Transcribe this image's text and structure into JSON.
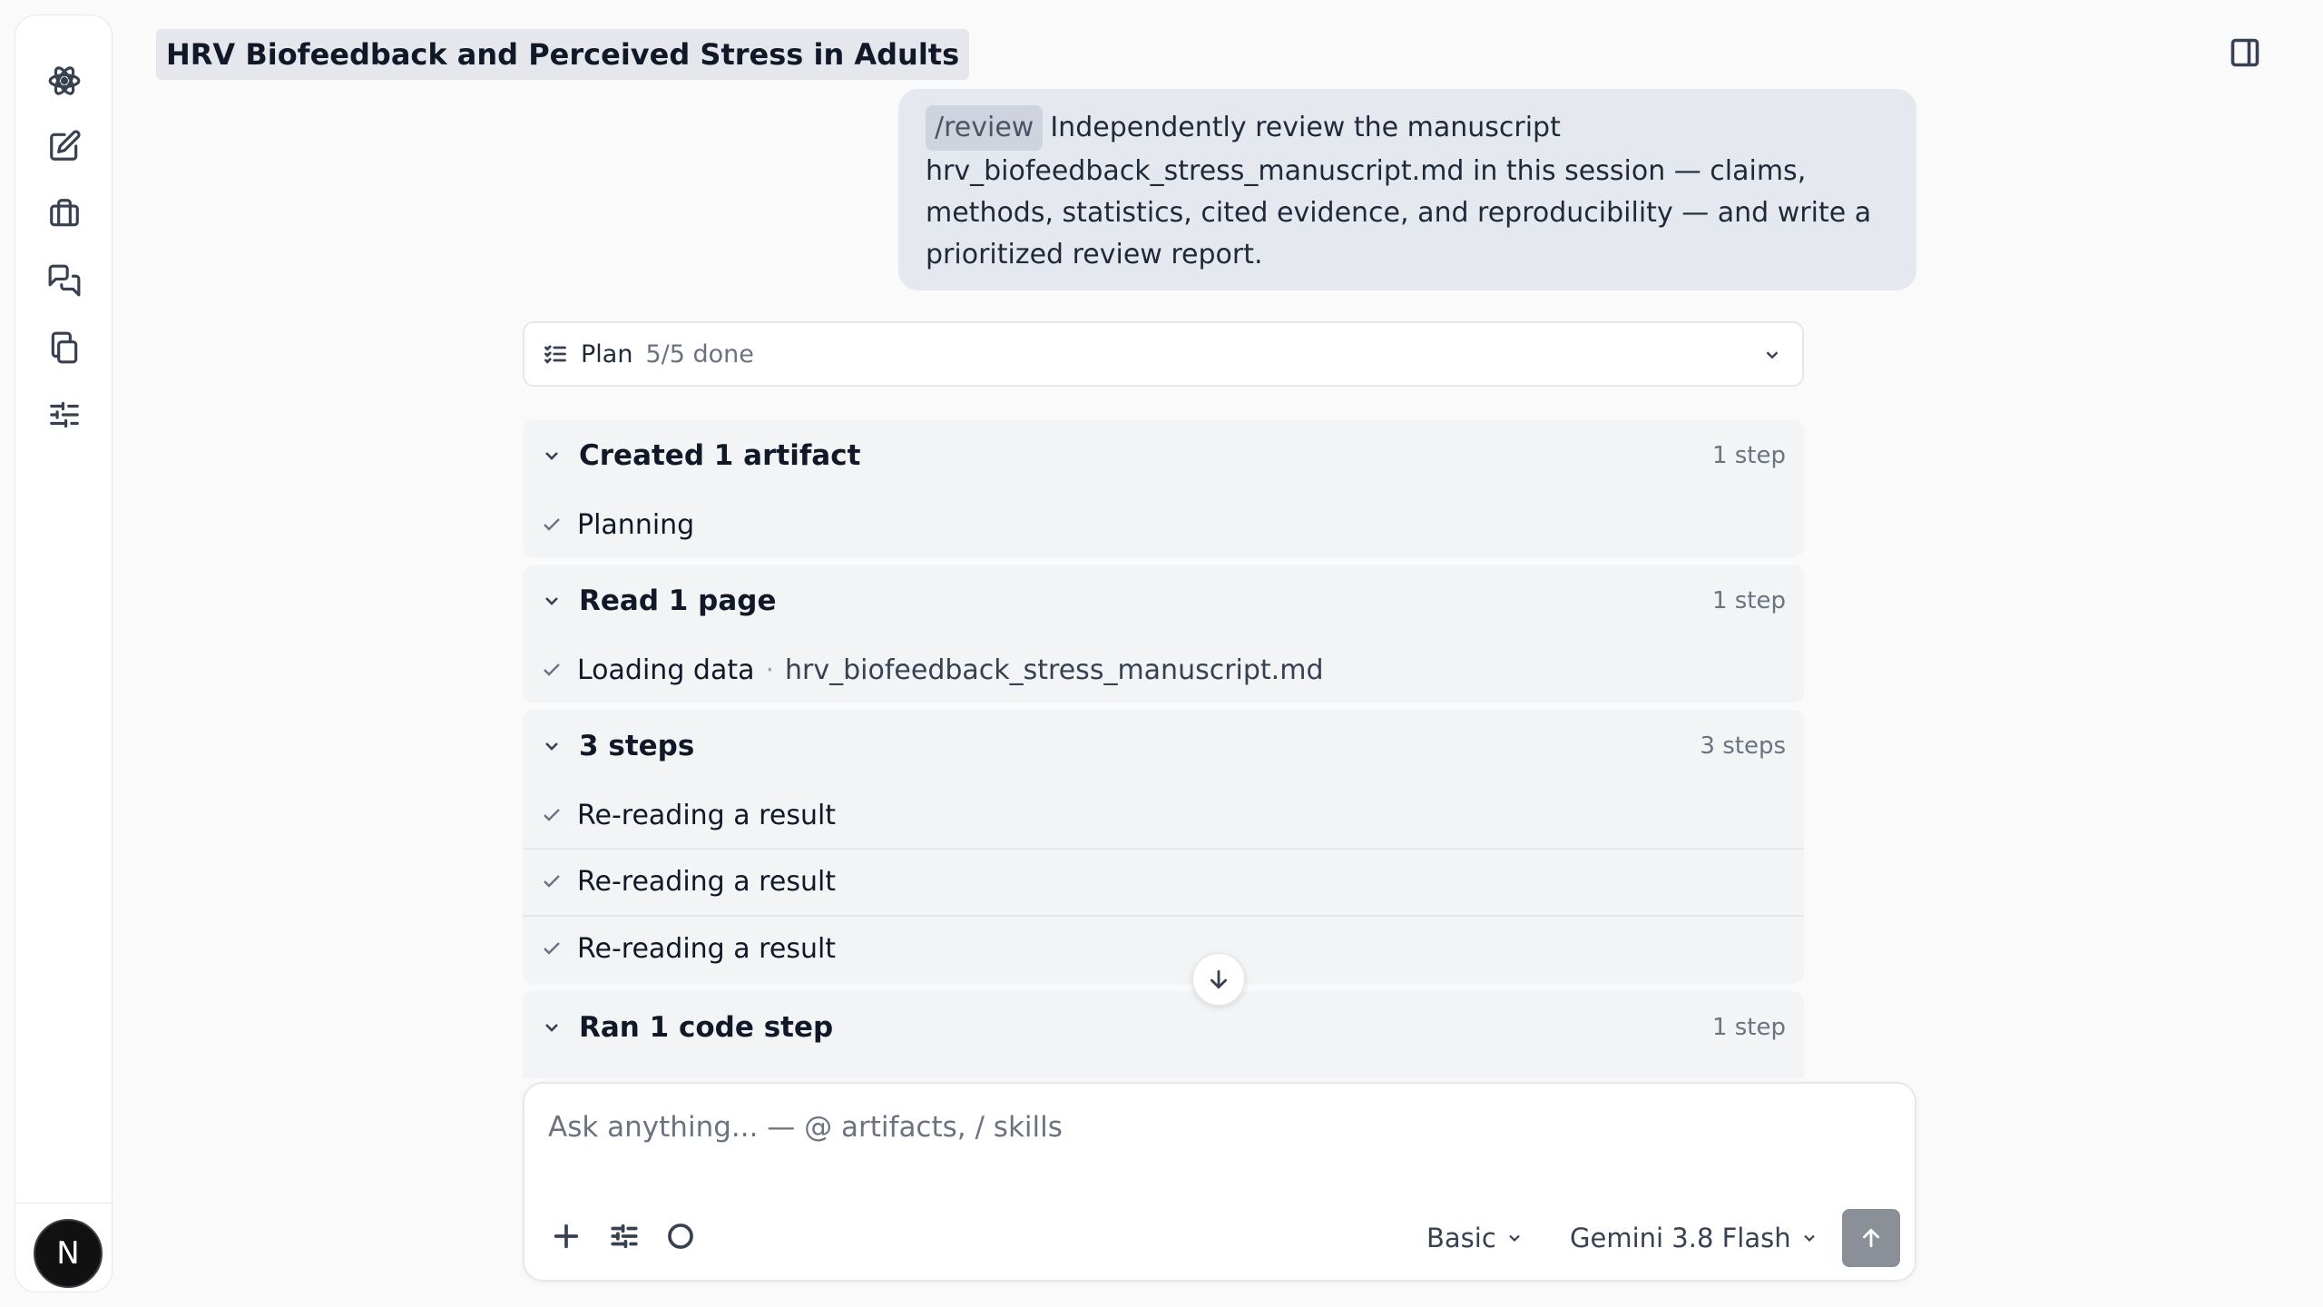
{
  "header": {
    "title": "HRV Biofeedback and Perceived Stress in Adults"
  },
  "sidebar": {
    "icons": [
      "atom-logo-icon",
      "new-chat-icon",
      "briefcase-icon",
      "chats-icon",
      "documents-icon",
      "settings-sliders-icon"
    ],
    "avatar_initial": "N"
  },
  "user_message": {
    "command": "/review",
    "text": "Independently review the manuscript hrv_biofeedback_stress_manuscript.md in this session — claims, methods, statistics, cited evidence, and reproducibility — and write a prioritized review report."
  },
  "plan": {
    "label": "Plan",
    "status": "5/5 done"
  },
  "groups": [
    {
      "title": "Created 1 artifact",
      "count": "1 step",
      "rows": [
        {
          "label": "Planning"
        }
      ]
    },
    {
      "title": "Read 1 page",
      "count": "1 step",
      "rows": [
        {
          "label": "Loading data",
          "detail": "hrv_biofeedback_stress_manuscript.md"
        }
      ]
    },
    {
      "title": "3 steps",
      "count": "3 steps",
      "rows": [
        {
          "label": "Re-reading a result"
        },
        {
          "label": "Re-reading a result"
        },
        {
          "label": "Re-reading a result"
        }
      ]
    },
    {
      "title": "Ran 1 code step",
      "count": "1 step",
      "rows": []
    }
  ],
  "detail_separator": "·",
  "composer": {
    "placeholder": "Ask anything... — @ artifacts, / skills",
    "mode": "Basic",
    "model": "Gemini 3.8 Flash"
  }
}
